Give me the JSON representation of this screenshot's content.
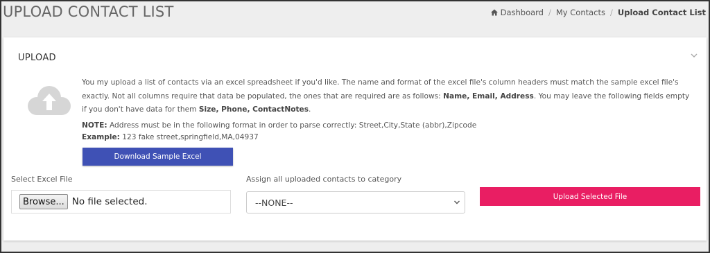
{
  "header": {
    "title": "UPLOAD CONTACT LIST",
    "breadcrumb": [
      {
        "label": "Dashboard",
        "icon": "home-icon"
      },
      {
        "label": "My Contacts"
      },
      {
        "label": "Upload Contact List"
      }
    ]
  },
  "card": {
    "title": "UPLOAD",
    "info": {
      "p1_a": "You my upload a list of contacts via an excel spreadsheet if you'd like. The name and format of the excel file's column headers must match the sample excel file's exactly. Not all columns require that data be populated, the ones that are required are as follows: ",
      "p1_required": "Name, Email, Address",
      "p1_b": ". You may leave the following fields empty if you don't have data for them ",
      "p1_optional": "Size, Phone, ContactNotes",
      "p1_c": ".",
      "note_label": "NOTE:",
      "note_text": " Address must be in the following format in order to parse correctly: Street,City,State (abbr),Zipcode",
      "example_label": "Example:",
      "example_text": " 123 fake street,springfield,MA,04937"
    },
    "download_button": "Download Sample Excel",
    "file_label": "Select Excel File",
    "browse_button": "Browse...",
    "file_status": "No file selected.",
    "category_label": "Assign all uploaded contacts to category",
    "category_selected": "--NONE--",
    "upload_button": "Upload Selected File"
  },
  "colors": {
    "download_button": "#3f51b5",
    "upload_button": "#e91e63",
    "background": "#eeeeee"
  }
}
